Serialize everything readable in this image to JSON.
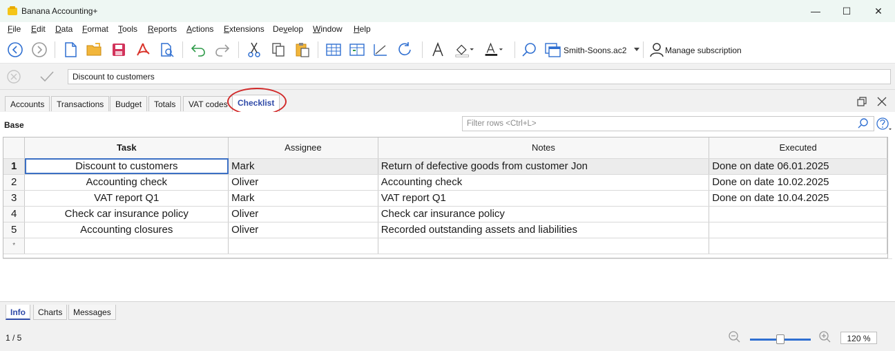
{
  "window": {
    "title": "Banana Accounting+",
    "minimize": "—",
    "maximize": "☐",
    "close": "✕"
  },
  "menu": [
    {
      "label": "File",
      "u": "F",
      "rest": "ile"
    },
    {
      "label": "Edit",
      "u": "E",
      "rest": "dit"
    },
    {
      "label": "Data",
      "u": "D",
      "rest": "ata"
    },
    {
      "label": "Format",
      "u": "F",
      "rest": "ormat"
    },
    {
      "label": "Tools",
      "u": "T",
      "rest": "ools"
    },
    {
      "label": "Reports",
      "u": "R",
      "rest": "eports"
    },
    {
      "label": "Actions",
      "u": "A",
      "rest": "ctions"
    },
    {
      "label": "Extensions",
      "u": "E",
      "rest": "xtensions"
    },
    {
      "label": "Develop",
      "pre": "De",
      "u": "v",
      "rest": "elop"
    },
    {
      "label": "Window",
      "u": "W",
      "rest": "indow"
    },
    {
      "label": "Help",
      "u": "H",
      "rest": "elp"
    }
  ],
  "toolbar": {
    "file_name": "Smith-Soons.ac2",
    "manage_subscription": "Manage subscription"
  },
  "editor": {
    "value": "Discount to customers"
  },
  "tabs": [
    "Accounts",
    "Transactions",
    "Budget",
    "Totals",
    "VAT codes",
    "Checklist"
  ],
  "active_tab": "Checklist",
  "view": {
    "name": "Base",
    "filter_placeholder": "Filter rows <Ctrl+L>"
  },
  "table": {
    "columns": [
      "Task",
      "Assignee",
      "Notes",
      "Executed"
    ],
    "rows": [
      {
        "num": "1",
        "task": "Discount to customers",
        "assignee": "Mark",
        "notes": "Return of defective goods from customer Jon",
        "executed": "Done on date 06.01.2025"
      },
      {
        "num": "2",
        "task": "Accounting check",
        "assignee": "Oliver",
        "notes": "Accounting check",
        "executed": "Done on date 10.02.2025"
      },
      {
        "num": "3",
        "task": "VAT report Q1",
        "assignee": "Mark",
        "notes": "VAT report Q1",
        "executed": "Done on date 10.04.2025"
      },
      {
        "num": "4",
        "task": "Check car insurance policy",
        "assignee": "Oliver",
        "notes": "Check car insurance policy",
        "executed": ""
      },
      {
        "num": "5",
        "task": "Accounting closures",
        "assignee": "Oliver",
        "notes": "Recorded outstanding assets and liabilities",
        "executed": ""
      }
    ],
    "new_row_marker": "*"
  },
  "bottom_tabs": [
    "Info",
    "Charts",
    "Messages"
  ],
  "status": {
    "position": "1 / 5",
    "zoom": "120 %"
  }
}
